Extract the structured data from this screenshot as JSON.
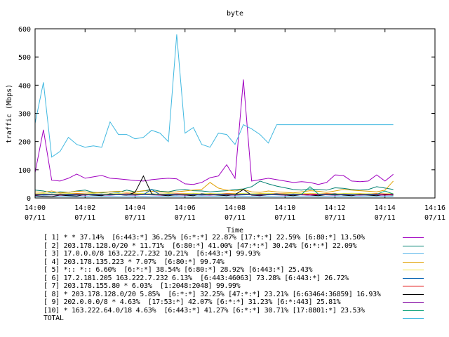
{
  "chart_data": {
    "type": "line",
    "title": "byte",
    "xlabel": "Time",
    "ylabel": "traffic (Mbps)",
    "ylim": [
      0,
      600
    ],
    "yticks": [
      0,
      100,
      200,
      300,
      400,
      500,
      600
    ],
    "xlim": [
      "14:00",
      "14:16"
    ],
    "xticks": [
      {
        "time": "14:00",
        "date": "07/11"
      },
      {
        "time": "14:02",
        "date": "07/11"
      },
      {
        "time": "14:04",
        "date": "07/11"
      },
      {
        "time": "14:06",
        "date": "07/11"
      },
      {
        "time": "14:08",
        "date": "07/11"
      },
      {
        "time": "14:10",
        "date": "07/11"
      },
      {
        "time": "14:12",
        "date": "07/11"
      },
      {
        "time": "14:14",
        "date": "07/11"
      },
      {
        "time": "14:16",
        "date": "07/11"
      }
    ],
    "x": [
      "14:00:00",
      "14:00:20",
      "14:00:40",
      "14:01:00",
      "14:01:20",
      "14:01:40",
      "14:02:00",
      "14:02:20",
      "14:02:40",
      "14:03:00",
      "14:03:20",
      "14:03:40",
      "14:04:00",
      "14:04:20",
      "14:04:40",
      "14:05:00",
      "14:05:20",
      "14:05:40",
      "14:06:00",
      "14:06:20",
      "14:06:40",
      "14:07:00",
      "14:07:20",
      "14:07:40",
      "14:08:00",
      "14:08:20",
      "14:08:40",
      "14:09:00",
      "14:09:20",
      "14:09:40",
      "14:10:00",
      "14:10:20",
      "14:10:40",
      "14:11:00",
      "14:11:20",
      "14:11:40",
      "14:12:00",
      "14:12:20",
      "14:12:40",
      "14:13:00",
      "14:13:20",
      "14:13:40",
      "14:14:00",
      "14:14:20"
    ],
    "series": [
      {
        "name": "[ 1] * * 37.14%  [6:443:*] 36.25% [6:*:*] 22.87% [17:*:*] 22.59% [6:80:*] 13.50%",
        "color": "#a000c0",
        "values": [
          90,
          242,
          63,
          60,
          70,
          85,
          70,
          75,
          80,
          70,
          68,
          65,
          62,
          60,
          65,
          68,
          70,
          68,
          50,
          48,
          55,
          72,
          78,
          118,
          70,
          420,
          60,
          65,
          70,
          65,
          60,
          55,
          58,
          55,
          48,
          55,
          82,
          80,
          60,
          58,
          60,
          82,
          60,
          84
        ]
      },
      {
        "name": "[ 2] 203.178.128.0/20 * 11.71%  [6:80:*] 41.00% [47:*:*] 30.24% [6:*:*] 22.09%",
        "color": "#008070",
        "values": [
          28,
          25,
          18,
          22,
          20,
          25,
          28,
          20,
          18,
          22,
          20,
          28,
          22,
          25,
          30,
          24,
          22,
          28,
          30,
          26,
          25,
          22,
          24,
          26,
          30,
          32,
          40,
          60,
          50,
          42,
          36,
          30,
          28,
          32,
          30,
          28,
          36,
          34,
          30,
          28,
          30,
          40,
          35,
          30
        ]
      },
      {
        "name": "[ 3] 17.0.0.0/8 163.222.7.232 10.21%  [6:443:*] 99.93%",
        "color": "#56b4e9",
        "values": [
          5,
          6,
          5,
          6,
          6,
          5,
          6,
          7,
          6,
          6,
          5,
          5,
          6,
          6,
          5,
          6,
          6,
          6,
          5,
          5,
          6,
          6,
          6,
          5,
          6,
          6,
          6,
          5,
          6,
          5,
          6,
          6,
          5,
          6,
          6,
          6,
          5,
          6,
          6,
          6,
          5,
          6,
          6,
          6
        ]
      },
      {
        "name": "[ 4] 203.178.135.223 * 7.07%  [6:80:*] 99.74%",
        "color": "#e0a000",
        "values": [
          22,
          20,
          25,
          18,
          20,
          24,
          22,
          18,
          20,
          22,
          24,
          20,
          22,
          26,
          24,
          22,
          20,
          22,
          25,
          28,
          30,
          55,
          35,
          28,
          25,
          30,
          22,
          20,
          25,
          22,
          20,
          18,
          22,
          26,
          24,
          20,
          25,
          30,
          28,
          26,
          24,
          22,
          28,
          60
        ]
      },
      {
        "name": "[ 5] *:: *:: 6.60%  [6:*:*] 38.54% [6:80:*] 28.92% [6:443:*] 25.43%",
        "color": "#f0e442",
        "values": [
          15,
          16,
          14,
          15,
          16,
          17,
          15,
          16,
          14,
          15,
          16,
          15,
          17,
          16,
          15,
          14,
          16,
          15,
          16,
          17,
          15,
          16,
          15,
          16,
          17,
          16,
          15,
          16,
          17,
          15,
          16,
          15,
          16,
          17,
          15,
          16,
          15,
          16,
          17,
          16,
          15,
          16,
          15,
          16
        ]
      },
      {
        "name": "[ 6] 17.2.181.205 163.222.7.232 6.13%  [6:443:46063] 73.28% [6:443:*] 26.72%",
        "color": "#0060b0",
        "values": [
          12,
          10,
          11,
          12,
          10,
          11,
          14,
          12,
          10,
          11,
          12,
          10,
          11,
          12,
          30,
          12,
          11,
          10,
          12,
          11,
          10,
          12,
          11,
          12,
          10,
          11,
          12,
          10,
          11,
          12,
          10,
          11,
          12,
          10,
          11,
          12,
          10,
          11,
          12,
          10,
          11,
          12,
          10,
          11
        ]
      },
      {
        "name": "[ 7] 203.178.155.80 * 6.03%  [1:2048:2048] 99.99%",
        "color": "#e00000",
        "values": [
          14,
          13,
          12,
          14,
          13,
          15,
          14,
          13,
          12,
          14,
          13,
          15,
          14,
          13,
          12,
          14,
          13,
          15,
          14,
          13,
          12,
          14,
          13,
          15,
          14,
          13,
          12,
          14,
          13,
          15,
          14,
          13,
          12,
          14,
          13,
          15,
          14,
          13,
          12,
          14,
          13,
          15,
          14,
          13
        ]
      },
      {
        "name": "[ 8] * 203.178.128.0/20 5.85%  [6:*:*] 32.25% [47:*:*] 23.21% [6:63464:36859] 16.93%",
        "color": "#000000",
        "values": [
          8,
          6,
          5,
          10,
          8,
          7,
          12,
          10,
          8,
          15,
          12,
          10,
          20,
          78,
          15,
          10,
          8,
          12,
          10,
          8,
          15,
          12,
          10,
          8,
          12,
          30,
          10,
          8,
          12,
          15,
          10,
          8,
          12,
          10,
          8,
          12,
          15,
          10,
          8,
          12,
          10,
          8,
          12,
          10
        ]
      },
      {
        "name": "[ 9] 202.0.0.0/8 * 4.63%  [17:53:*] 42.07% [6:*:*] 31.23% [6:*:443] 25.81%",
        "color": "#8000a0",
        "values": [
          10,
          12,
          11,
          10,
          12,
          11,
          10,
          12,
          11,
          10,
          12,
          11,
          10,
          12,
          11,
          10,
          12,
          11,
          10,
          12,
          11,
          10,
          12,
          11,
          10,
          12,
          11,
          10,
          12,
          11,
          10,
          12,
          11,
          10,
          12,
          11,
          10,
          12,
          11,
          10,
          12,
          11,
          10,
          12
        ]
      },
      {
        "name": "[10] * 163.222.64.0/18 4.63%  [6:443:*] 41.27% [6:*:*] 30.71% [17:8801:*] 23.53%",
        "color": "#009e73",
        "values": [
          12,
          14,
          13,
          12,
          14,
          13,
          12,
          14,
          13,
          12,
          14,
          13,
          12,
          14,
          13,
          12,
          14,
          13,
          12,
          14,
          13,
          12,
          14,
          13,
          12,
          14,
          13,
          12,
          14,
          13,
          12,
          14,
          13,
          40,
          14,
          13,
          12,
          14,
          13,
          12,
          14,
          13,
          25,
          14
        ]
      },
      {
        "name": "TOTAL",
        "color": "#40b8e0",
        "values": [
          265,
          410,
          145,
          165,
          215,
          190,
          180,
          185,
          180,
          270,
          225,
          225,
          210,
          215,
          240,
          230,
          200,
          580,
          230,
          250,
          190,
          180,
          230,
          225,
          190,
          260,
          245,
          225,
          195,
          260,
          260,
          260,
          260,
          260,
          260,
          260,
          260,
          260,
          260,
          260,
          260,
          260,
          260,
          260
        ]
      }
    ]
  }
}
